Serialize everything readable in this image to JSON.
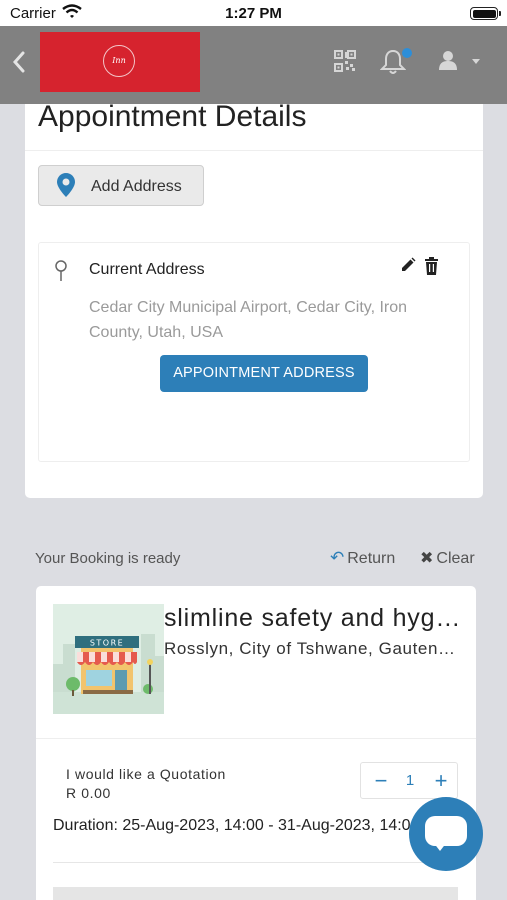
{
  "status_bar": {
    "carrier": "Carrier",
    "time": "1:27 PM"
  },
  "navbar": {
    "logo_text": "Inn",
    "icons": [
      "chevron-left-icon",
      "qr-code-icon",
      "bell-icon",
      "user-icon",
      "caret-down-icon"
    ],
    "colors": {
      "bar": "#818181",
      "logo_bg": "#d6232e",
      "notification_dot": "#2d8ed8"
    }
  },
  "appointment": {
    "title": "Appointment Details",
    "add_address_label": "Add Address",
    "current_address_title": "Current Address",
    "current_address_text": "Cedar City Municipal Airport, Cedar City, Iron County, Utah, USA",
    "appointment_address_button": "APPOINTMENT ADDRESS"
  },
  "booking": {
    "ready_text": "Your Booking is ready",
    "return_label": "Return",
    "clear_label": "Clear",
    "store_name": "slimline safety and hygiene",
    "store_location": "Rosslyn, City of Tshwane, Gauteng, South Africa",
    "store_sign": "STORE",
    "item_label": "I would like a Quotation",
    "item_price": "R 0.00",
    "quantity": "1",
    "duration": "Duration: 25-Aug-2023, 14:00 - 31-Aug-2023, 14:00"
  },
  "theme": {
    "accent": "#2d7fb8",
    "background": "#dcdde2"
  }
}
